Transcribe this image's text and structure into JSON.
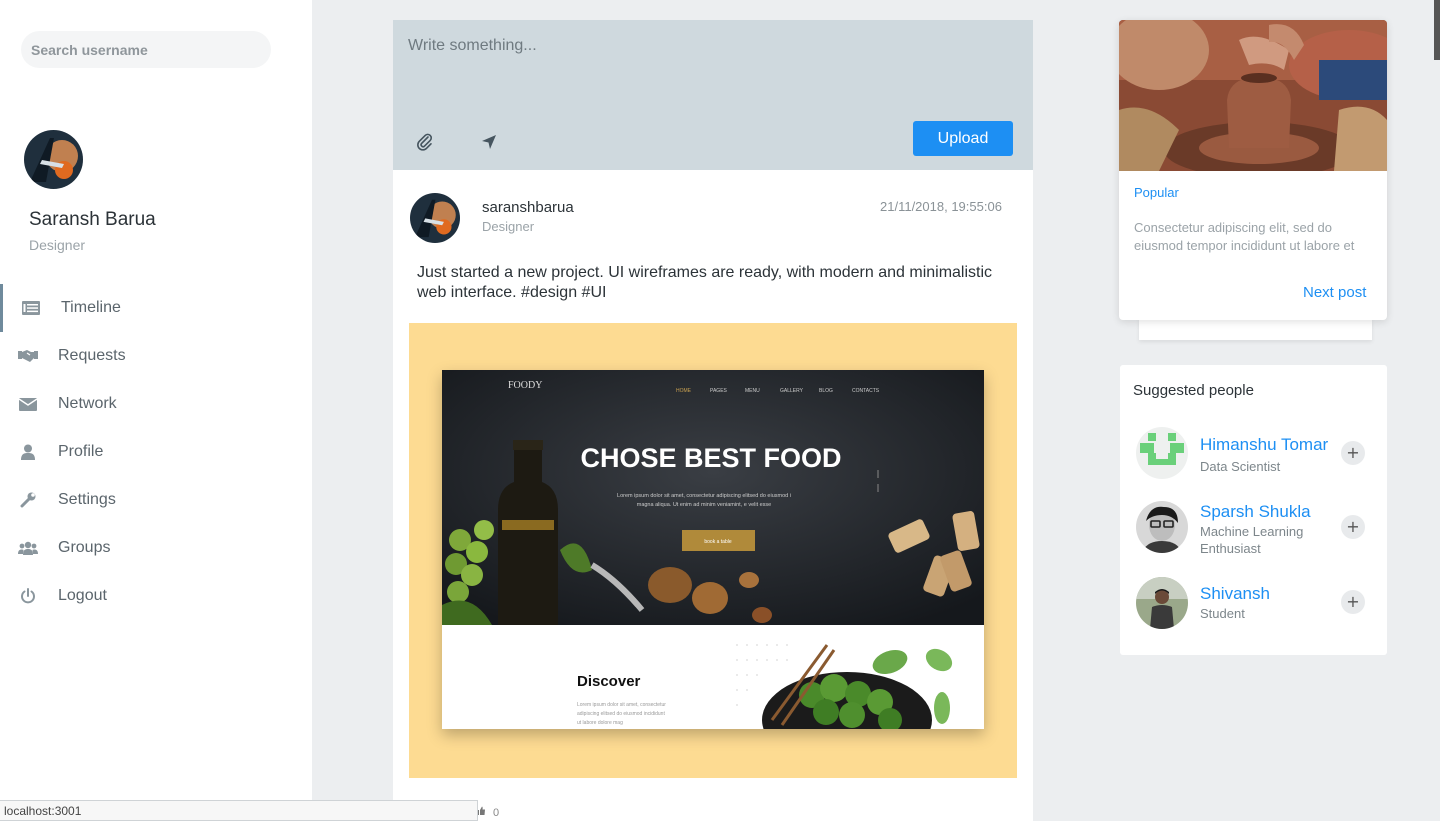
{
  "sidebar": {
    "search_placeholder": "Search username",
    "user": {
      "name": "Saransh Barua",
      "role": "Designer"
    },
    "nav": [
      {
        "label": "Timeline",
        "icon": "timeline-icon",
        "active": true
      },
      {
        "label": "Requests",
        "icon": "handshake-icon"
      },
      {
        "label": "Network",
        "icon": "envelope-icon"
      },
      {
        "label": "Profile",
        "icon": "user-icon"
      },
      {
        "label": "Settings",
        "icon": "wrench-icon"
      },
      {
        "label": "Groups",
        "icon": "users-icon"
      },
      {
        "label": "Logout",
        "icon": "power-icon"
      }
    ]
  },
  "composer": {
    "placeholder": "Write something...",
    "upload_label": "Upload"
  },
  "post": {
    "username": "saranshbarua",
    "role": "Designer",
    "timestamp": "21/11/2018, 19:55:06",
    "text": "Just started a new project. UI wireframes are ready, with modern and minimalistic web interface. #design #UI",
    "likes": "0",
    "mockup": {
      "brand": "FOODY",
      "nav": [
        "HOME",
        "PAGES",
        "MENU",
        "GALLERY",
        "BLOG",
        "CONTACTS"
      ],
      "headline": "CHOSE BEST FOOD",
      "subtext_1": "Lorem ipsum dolor sit amet, consectetur adipiscing elitsed do eiusmod i",
      "subtext_2": "magna aliqua. Ut enim ad minim veniamint, e velit esse",
      "cta": "book a table",
      "section_title": "Discover",
      "section_text_1": "Lorem ipsum dolor sit amet, consectetur",
      "section_text_2": "adipiscing elitsed do eiusmod incididunt",
      "section_text_3": "ut labore dolore mag"
    }
  },
  "popular": {
    "tag": "Popular",
    "text": "Consectetur adipiscing elit, sed do eiusmod tempor incididunt ut labore et",
    "next_label": "Next post"
  },
  "suggested": {
    "title": "Suggested people",
    "people": [
      {
        "name": "Himanshu Tomar",
        "role": "Data Scientist"
      },
      {
        "name": "Sparsh Shukla",
        "role": "Machine Learning Enthusiast"
      },
      {
        "name": "Shivansh",
        "role": "Student"
      }
    ],
    "add_label": "+"
  },
  "statusbar": {
    "url": "localhost:3001"
  },
  "colors": {
    "accent": "#1d8ff3",
    "composer_bg": "#cfd9de",
    "post_image_bg": "#fddb92",
    "page_bg": "#eceef0"
  }
}
